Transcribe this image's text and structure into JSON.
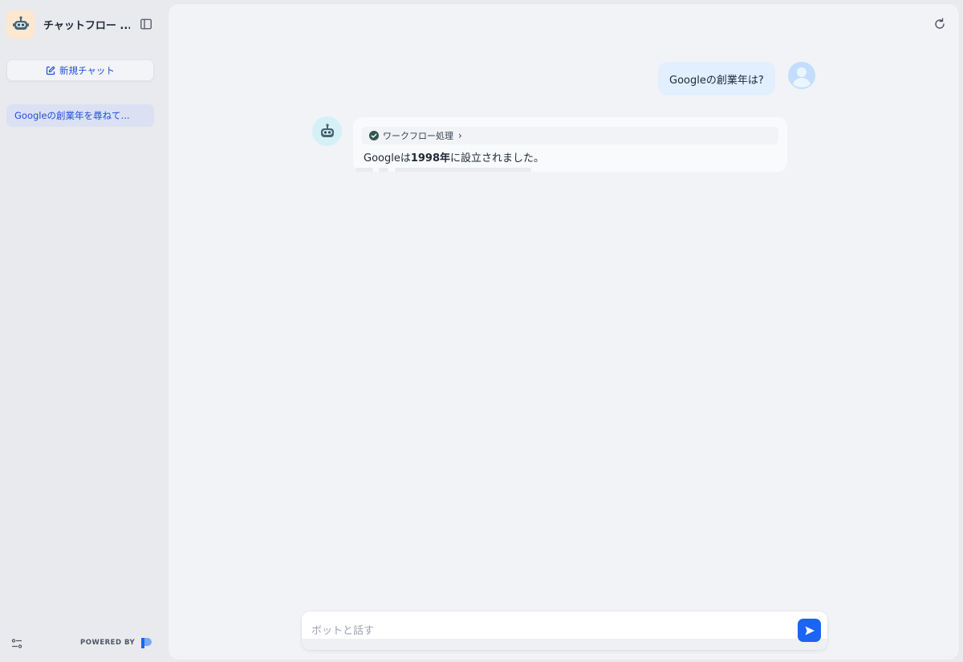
{
  "sidebar": {
    "app_title": "チャットフロー ...",
    "new_chat_label": "新規チャット",
    "conversations": [
      {
        "label": "Googleの創業年を尋ねて..."
      }
    ],
    "powered_by": "POWERED BY"
  },
  "chat": {
    "user_message": "Googleの創業年は?",
    "workflow_label": "ワークフロー処理",
    "answer_prefix": "Googleは",
    "answer_bold": "1998年",
    "answer_suffix": "に設立されました。"
  },
  "input": {
    "placeholder": "ボットと話す",
    "value": ""
  },
  "colors": {
    "accent": "#1c64f2",
    "link": "#1d4fd7",
    "user_bubble": "#e1effe",
    "success": "#16a34a"
  }
}
